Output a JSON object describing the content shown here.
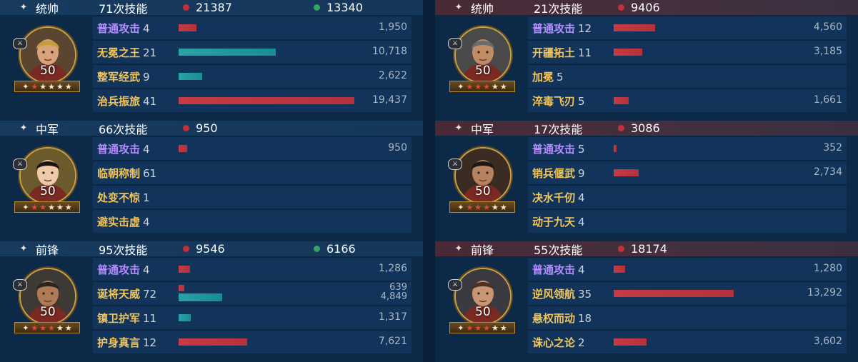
{
  "left": [
    {
      "role": "统帅",
      "role_icon": "banner-icon",
      "casts": "71次技能",
      "damage": "21387",
      "heal": "13340",
      "level": "50",
      "stars_red": 1,
      "skills": [
        {
          "name": "普通攻击",
          "count": "4",
          "color": "purple",
          "dmg": 1950,
          "dmg_label": "1,950",
          "heal": 0,
          "heal_label": ""
        },
        {
          "name": "无冕之王",
          "count": "21",
          "color": "gold",
          "dmg": 0,
          "dmg_label": "10,718",
          "heal": 10718,
          "heal_label": ""
        },
        {
          "name": "整军经武",
          "count": "9",
          "color": "gold",
          "dmg": 0,
          "dmg_label": "2,622",
          "heal": 2622,
          "heal_label": ""
        },
        {
          "name": "治兵振旅",
          "count": "41",
          "color": "gold",
          "dmg": 19437,
          "dmg_label": "19,437",
          "heal": 0,
          "heal_label": ""
        }
      ]
    },
    {
      "role": "中军",
      "role_icon": "sparkle-icon",
      "casts": "66次技能",
      "damage": "950",
      "heal": "",
      "level": "50",
      "stars_red": 2,
      "skills": [
        {
          "name": "普通攻击",
          "count": "4",
          "color": "purple",
          "dmg": 950,
          "dmg_label": "950",
          "heal": 0,
          "heal_label": ""
        },
        {
          "name": "临朝称制",
          "count": "61",
          "color": "gold",
          "dmg": 0,
          "dmg_label": "",
          "heal": 0,
          "heal_label": ""
        },
        {
          "name": "处变不惊",
          "count": "1",
          "color": "gold",
          "dmg": 0,
          "dmg_label": "",
          "heal": 0,
          "heal_label": ""
        },
        {
          "name": "避实击虚",
          "count": "4",
          "color": "gold",
          "dmg": 0,
          "dmg_label": "",
          "heal": 0,
          "heal_label": ""
        }
      ]
    },
    {
      "role": "前锋",
      "role_icon": "sparkle-icon",
      "casts": "95次技能",
      "damage": "9546",
      "heal": "6166",
      "level": "50",
      "stars_red": 3,
      "skills": [
        {
          "name": "普通攻击",
          "count": "4",
          "color": "purple",
          "dmg": 1286,
          "dmg_label": "1,286",
          "heal": 0,
          "heal_label": ""
        },
        {
          "name": "诞将天威",
          "count": "72",
          "color": "gold",
          "dmg": 639,
          "dmg_label": "639",
          "heal": 4849,
          "heal_label": "4,849"
        },
        {
          "name": "镇卫护军",
          "count": "11",
          "color": "gold",
          "dmg": 0,
          "dmg_label": "1,317",
          "heal": 1317,
          "heal_label": ""
        },
        {
          "name": "护身真言",
          "count": "12",
          "color": "gold",
          "dmg": 7621,
          "dmg_label": "7,621",
          "heal": 0,
          "heal_label": ""
        }
      ]
    }
  ],
  "right": [
    {
      "role": "统帅",
      "role_icon": "sparkle-icon",
      "casts": "21次技能",
      "damage": "9406",
      "heal": "",
      "level": "50",
      "stars_red": 3,
      "skills": [
        {
          "name": "普通攻击",
          "count": "12",
          "color": "purple",
          "dmg": 4560,
          "dmg_label": "4,560",
          "heal": 0,
          "heal_label": ""
        },
        {
          "name": "开疆拓土",
          "count": "11",
          "color": "gold",
          "dmg": 3185,
          "dmg_label": "3,185",
          "heal": 0,
          "heal_label": ""
        },
        {
          "name": "加冕",
          "count": "5",
          "color": "gold",
          "dmg": 0,
          "dmg_label": "",
          "heal": 0,
          "heal_label": ""
        },
        {
          "name": "淬毒飞刃",
          "count": "5",
          "color": "gold",
          "dmg": 1661,
          "dmg_label": "1,661",
          "heal": 0,
          "heal_label": ""
        }
      ]
    },
    {
      "role": "中军",
      "role_icon": "sparkle-icon",
      "casts": "17次技能",
      "damage": "3086",
      "heal": "",
      "level": "50",
      "stars_red": 3,
      "skills": [
        {
          "name": "普通攻击",
          "count": "5",
          "color": "purple",
          "dmg": 352,
          "dmg_label": "352",
          "heal": 0,
          "heal_label": ""
        },
        {
          "name": "销兵偃武",
          "count": "9",
          "color": "gold",
          "dmg": 2734,
          "dmg_label": "2,734",
          "heal": 0,
          "heal_label": ""
        },
        {
          "name": "决水千仞",
          "count": "4",
          "color": "gold",
          "dmg": 0,
          "dmg_label": "",
          "heal": 0,
          "heal_label": ""
        },
        {
          "name": "动于九天",
          "count": "4",
          "color": "gold",
          "dmg": 0,
          "dmg_label": "",
          "heal": 0,
          "heal_label": ""
        }
      ]
    },
    {
      "role": "前锋",
      "role_icon": "sparkle-icon",
      "casts": "55次技能",
      "damage": "18174",
      "heal": "",
      "level": "50",
      "stars_red": 3,
      "skills": [
        {
          "name": "普通攻击",
          "count": "4",
          "color": "purple",
          "dmg": 1280,
          "dmg_label": "1,280",
          "heal": 0,
          "heal_label": ""
        },
        {
          "name": "逆风领航",
          "count": "35",
          "color": "gold",
          "dmg": 13292,
          "dmg_label": "13,292",
          "heal": 0,
          "heal_label": ""
        },
        {
          "name": "悬权而动",
          "count": "18",
          "color": "gold",
          "dmg": 0,
          "dmg_label": "",
          "heal": 0,
          "heal_label": ""
        },
        {
          "name": "诛心之论",
          "count": "2",
          "color": "gold",
          "dmg": 3602,
          "dmg_label": "3,602",
          "heal": 0,
          "heal_label": ""
        }
      ]
    }
  ],
  "colors": {
    "damage": "#c2303a",
    "heal": "#31a45f",
    "skill_basic": "#b48cff",
    "skill_tactic": "#f1c55a"
  }
}
